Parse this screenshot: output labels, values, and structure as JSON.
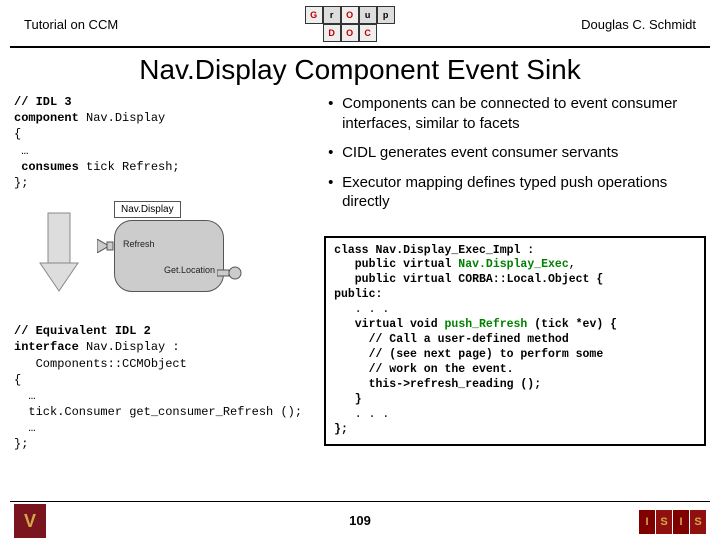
{
  "header": {
    "left": "Tutorial on CCM",
    "right": "Douglas C. Schmidt",
    "logo": [
      "G",
      "r",
      "O",
      "u",
      "p",
      "D",
      "O",
      "C"
    ]
  },
  "title": "Nav.Display Component Event Sink",
  "idl3": {
    "l1": "// IDL 3",
    "l2": "component",
    "l2b": " Nav.Display",
    "l3": "{",
    "l4": " …",
    "l5": " consumes",
    "l5b": " tick Refresh;",
    "l6": "};"
  },
  "bullets": {
    "b1": "Components can be connected to event consumer interfaces, similar to facets",
    "b2": "CIDL generates event consumer servants",
    "b3": "Executor mapping defines typed push operations directly"
  },
  "diagram": {
    "compName": "Nav.Display",
    "port1": "Refresh",
    "port2": "Get.Location"
  },
  "idl2": {
    "l1": "// Equivalent IDL 2",
    "l2a": "interface",
    "l2b": " Nav.Display :",
    "l3": "   Components::CCMObject",
    "l4": "{",
    "l5": "  …",
    "l6": "  tick.Consumer get_consumer_Refresh ();",
    "l7": "  …",
    "l8": "};"
  },
  "classbox": {
    "l1": "class Nav.Display_Exec_Impl :",
    "l2": "   public virtual",
    "l2b": " Nav.Display_Exec",
    "l2c": ",",
    "l3": "   public virtual CORBA::Local.Object {",
    "l4": "public:",
    "l5": "   . . .",
    "l6": "   virtual void",
    "l6b": " push_Refresh",
    "l6c": " (tick *ev) {",
    "l7": "     // Call a user-defined method",
    "l8": "     // (see next page) to perform some",
    "l9": "     // work on the event.",
    "l10": "     this->refresh_reading ();",
    "l11": "   }",
    "l12": "   . . .",
    "l13": "};"
  },
  "footer": {
    "page": "109",
    "leftLogo": "V",
    "rightLogo": [
      "I",
      "S",
      "I",
      "S"
    ]
  }
}
